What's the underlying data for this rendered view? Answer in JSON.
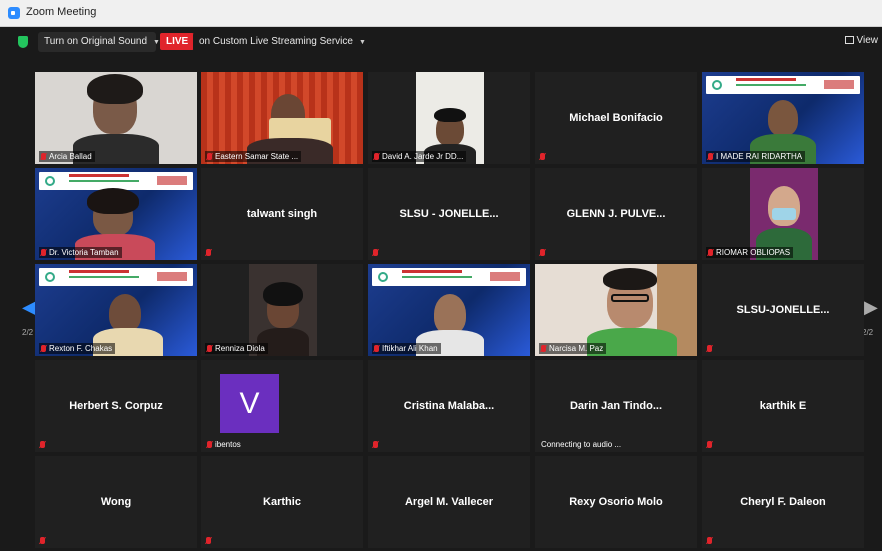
{
  "window": {
    "title": "Zoom Meeting"
  },
  "toolbar": {
    "original_sound": "Turn on Original Sound",
    "live_badge": "LIVE",
    "streaming": "on Custom Live Streaming Service",
    "view": "View"
  },
  "pagination": {
    "left": "2/2",
    "right": "2/2"
  },
  "participants": [
    {
      "name": "Arcia Ballad",
      "type": "video"
    },
    {
      "name": "Eastern Samar State ...",
      "type": "video"
    },
    {
      "name": "David A. Jarde Jr DD...",
      "type": "video"
    },
    {
      "name": "Michael Bonifacio",
      "type": "name"
    },
    {
      "name": "I MADE RAI RIDARTHA",
      "type": "video"
    },
    {
      "name": "Dr. Victoria Tamban",
      "type": "video"
    },
    {
      "name": "talwant singh",
      "type": "name"
    },
    {
      "name": "SLSU - JONELLE...",
      "type": "name"
    },
    {
      "name": "GLENN J. PULVE...",
      "type": "name"
    },
    {
      "name": "RIOMAR OBLIOPAS",
      "type": "video"
    },
    {
      "name": "Rexton F. Chakas",
      "type": "video"
    },
    {
      "name": "Renniza Diola",
      "type": "video"
    },
    {
      "name": "Iftikhar Ali Khan",
      "type": "video"
    },
    {
      "name": "Narcisa M. Paz",
      "type": "video"
    },
    {
      "name": "SLSU-JONELLE...",
      "type": "name"
    },
    {
      "name": "Herbert S. Corpuz",
      "type": "name"
    },
    {
      "name": "ibentos",
      "avatar_letter": "V",
      "type": "avatar"
    },
    {
      "name": "Cristina  Malaba...",
      "type": "name"
    },
    {
      "name": "Darin Jan Tindo...",
      "status": "Connecting to audio ...",
      "type": "name"
    },
    {
      "name": "karthik E",
      "type": "name"
    },
    {
      "name": "Wong",
      "type": "name"
    },
    {
      "name": "Karthic",
      "type": "name"
    },
    {
      "name": "Argel M. Vallecer",
      "type": "name"
    },
    {
      "name": "Rexy Osorio Molo",
      "type": "name"
    },
    {
      "name": "Cheryl F. Daleon",
      "type": "name"
    }
  ],
  "colors": {
    "accent": "#2d8cff",
    "live": "#e0242b",
    "muted": "#e0242b"
  }
}
